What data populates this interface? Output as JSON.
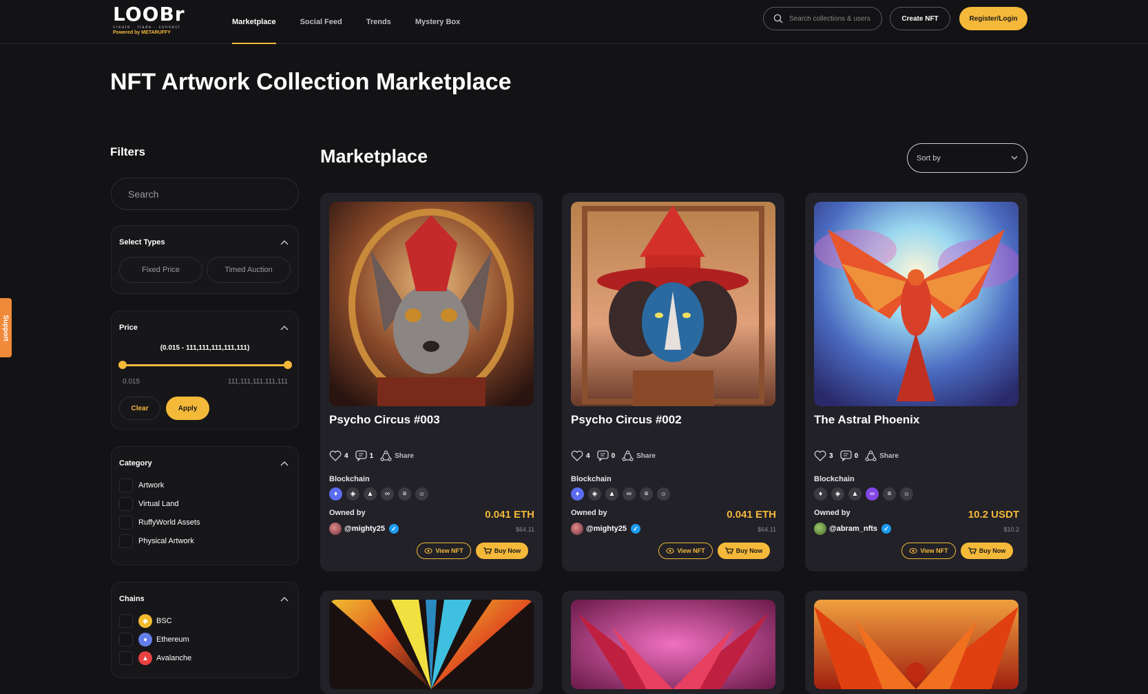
{
  "brand": {
    "logo_word": "LOOBr",
    "tagline": "create · trade · connect",
    "powered": "Powered by METARUFFY"
  },
  "nav": {
    "items": [
      "Marketplace",
      "Social Feed",
      "Trends",
      "Mystery Box"
    ],
    "active": "Marketplace",
    "search_placeholder": "Search collections & users",
    "create_label": "Create NFT",
    "register_label": "Register/Login"
  },
  "support_label": "Support",
  "page_title": "NFT Artwork Collection Marketplace",
  "filters": {
    "title": "Filters",
    "search_placeholder": "Search",
    "types": {
      "title": "Select Types",
      "options": [
        "Fixed Price",
        "Timed Auction"
      ]
    },
    "price": {
      "title": "Price",
      "range_text": "(0.015 - 111,111,111,111,111)",
      "min": "0.015",
      "max": "111,111,111,111,111",
      "clear_label": "Clear",
      "apply_label": "Apply"
    },
    "category": {
      "title": "Category",
      "options": [
        "Artwork",
        "Virtual Land",
        "RuffyWorld Assets",
        "Physical Artwork"
      ]
    },
    "chains": {
      "title": "Chains",
      "options": [
        "BSC",
        "Ethereum",
        "Avalanche"
      ]
    }
  },
  "market": {
    "title": "Marketplace",
    "sort_label": "Sort by"
  },
  "cards": [
    {
      "name": "Psycho Circus #003",
      "likes": "4",
      "comments": "1",
      "share_label": "Share",
      "blockchain_label": "Blockchain",
      "owned_label": "Owned by",
      "owner": "@mighty25",
      "price": "0.041 ETH",
      "price_usd": "$64.11",
      "view_label": "View NFT",
      "buy_label": "Buy Now"
    },
    {
      "name": "Psycho Circus #002",
      "likes": "4",
      "comments": "0",
      "share_label": "Share",
      "blockchain_label": "Blockchain",
      "owned_label": "Owned by",
      "owner": "@mighty25",
      "price": "0.041 ETH",
      "price_usd": "$64.11",
      "view_label": "View NFT",
      "buy_label": "Buy Now"
    },
    {
      "name": "The Astral Phoenix",
      "likes": "3",
      "comments": "0",
      "share_label": "Share",
      "blockchain_label": "Blockchain",
      "owned_label": "Owned by",
      "owner": "@abram_nfts",
      "price": "10.2 USDT",
      "price_usd": "$10.2",
      "view_label": "View NFT",
      "buy_label": "Buy Now"
    }
  ],
  "colors": {
    "accent": "#f5b93a",
    "background": "#131315",
    "card": "#212127",
    "verified": "#1d9bf0"
  }
}
